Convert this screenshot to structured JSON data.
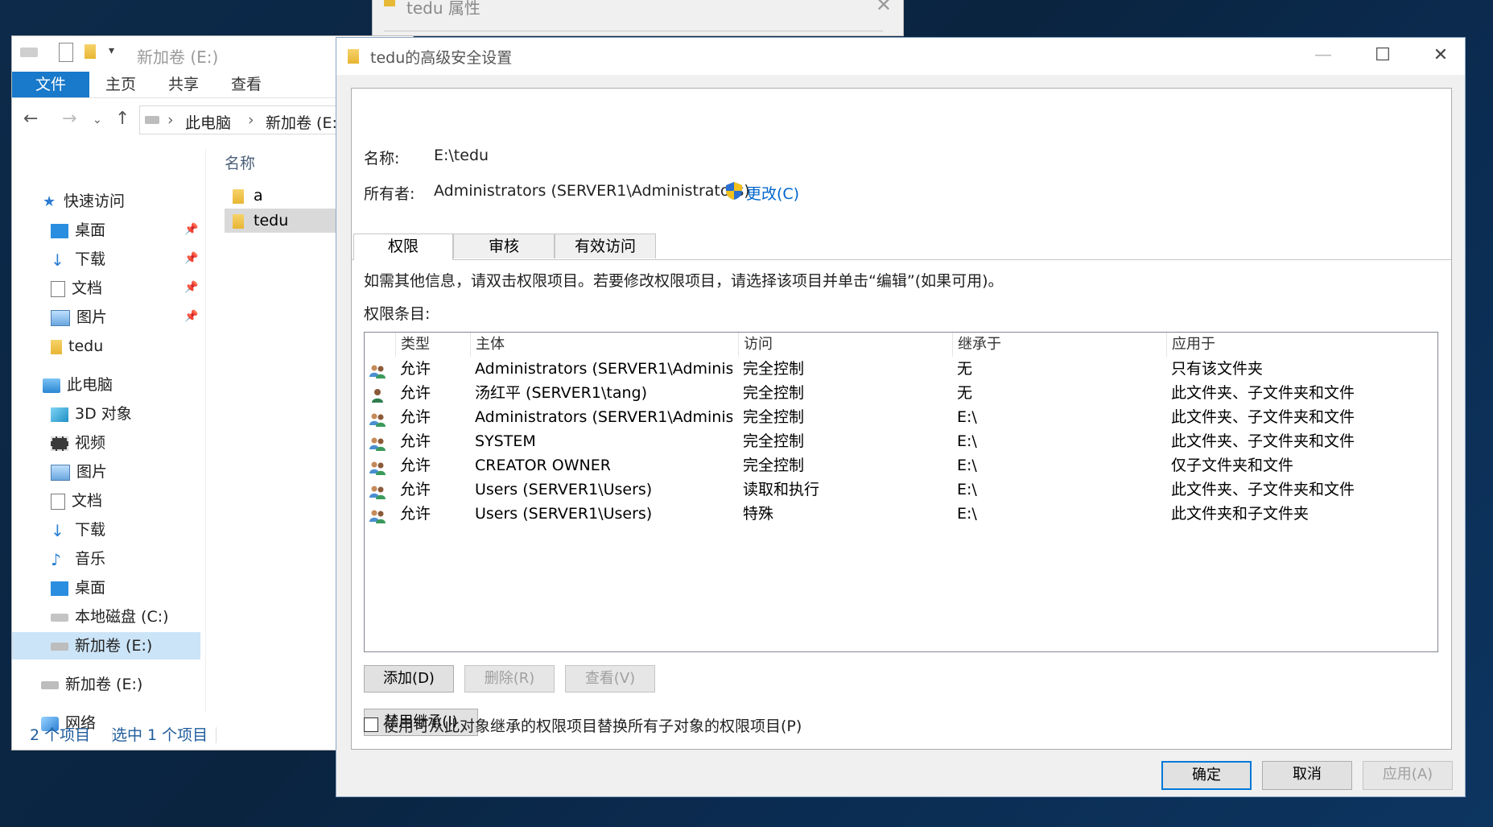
{
  "bg_window": {
    "title": "tedu 属性"
  },
  "explorer": {
    "title": "新加卷 (E:)",
    "ribbon_tabs": [
      "文件",
      "主页",
      "共享",
      "查看"
    ],
    "breadcrumb": [
      "此电脑",
      "新加卷 (E:)"
    ],
    "nav": {
      "quick_access": "快速访问",
      "quick_items": [
        "桌面",
        "下载",
        "文档",
        "图片",
        "tedu"
      ],
      "this_pc": "此电脑",
      "pc_items": [
        "3D 对象",
        "视频",
        "图片",
        "文档",
        "下载",
        "音乐",
        "桌面",
        "本地磁盘 (C:)",
        "新加卷 (E:)"
      ],
      "drive": "新加卷 (E:)",
      "network": "网络"
    },
    "column_name": "名称",
    "files": [
      "a",
      "tedu"
    ],
    "status": {
      "count": "2 个项目",
      "selected": "选中 1 个项目"
    }
  },
  "dialog": {
    "title": "tedu的高级安全设置",
    "name_label": "名称:",
    "name_value": "E:\\tedu",
    "owner_label": "所有者:",
    "owner_value": "Administrators (SERVER1\\Administrators)",
    "change_link": "更改(C)",
    "tabs": [
      "权限",
      "审核",
      "有效访问"
    ],
    "info_text": "如需其他信息，请双击权限项目。若要修改权限项目，请选择该项目并单击“编辑”(如果可用)。",
    "entries_label": "权限条目:",
    "columns": [
      "类型",
      "主体",
      "访问",
      "继承于",
      "应用于"
    ],
    "rows": [
      {
        "type": "允许",
        "principal": "Administrators (SERVER1\\Administr...",
        "access": "完全控制",
        "inherited": "无",
        "applies": "只有该文件夹",
        "icon": "group-icon"
      },
      {
        "type": "允许",
        "principal": "汤红平 (SERVER1\\tang)",
        "access": "完全控制",
        "inherited": "无",
        "applies": "此文件夹、子文件夹和文件",
        "icon": "user-icon"
      },
      {
        "type": "允许",
        "principal": "Administrators (SERVER1\\Administr...",
        "access": "完全控制",
        "inherited": "E:\\",
        "applies": "此文件夹、子文件夹和文件",
        "icon": "group-icon"
      },
      {
        "type": "允许",
        "principal": "SYSTEM",
        "access": "完全控制",
        "inherited": "E:\\",
        "applies": "此文件夹、子文件夹和文件",
        "icon": "group-icon"
      },
      {
        "type": "允许",
        "principal": "CREATOR OWNER",
        "access": "完全控制",
        "inherited": "E:\\",
        "applies": "仅子文件夹和文件",
        "icon": "group-icon"
      },
      {
        "type": "允许",
        "principal": "Users (SERVER1\\Users)",
        "access": "读取和执行",
        "inherited": "E:\\",
        "applies": "此文件夹、子文件夹和文件",
        "icon": "group-icon"
      },
      {
        "type": "允许",
        "principal": "Users (SERVER1\\Users)",
        "access": "特殊",
        "inherited": "E:\\",
        "applies": "此文件夹和子文件夹",
        "icon": "group-icon"
      }
    ],
    "buttons": {
      "add": "添加(D)",
      "remove": "删除(R)",
      "view": "查看(V)",
      "disable_inheritance": "禁用继承(I)"
    },
    "replace_checkbox": "使用可从此对象继承的权限项目替换所有子对象的权限项目(P)",
    "footer": {
      "ok": "确定",
      "cancel": "取消",
      "apply": "应用(A)"
    }
  },
  "colors": {
    "accent": "#0078d7",
    "ribbon_file": "#1979ca",
    "link": "#0066cc"
  }
}
